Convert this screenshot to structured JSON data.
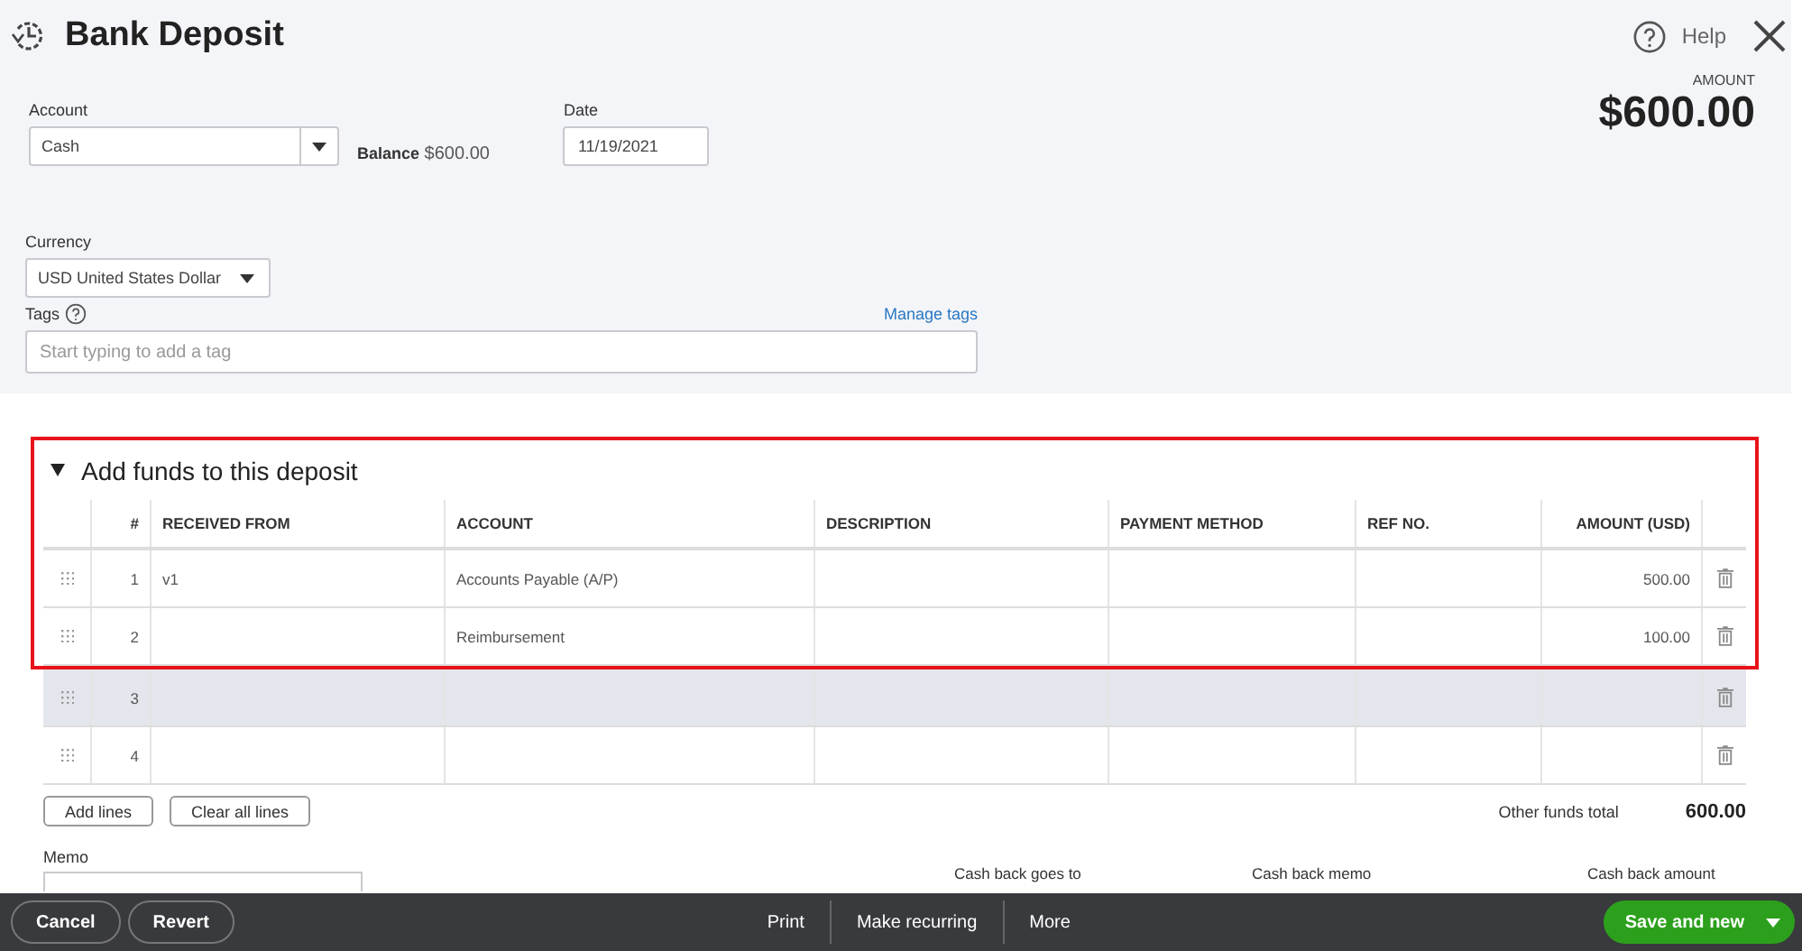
{
  "window": {
    "title": "Bank Deposit",
    "help": "Help"
  },
  "form": {
    "account_label": "Account",
    "account_value": "Cash",
    "balance_label": "Balance",
    "balance_value": "$600.00",
    "date_label": "Date",
    "date_value": "11/19/2021",
    "currency_label": "Currency",
    "currency_value": "USD United States Dollar",
    "tags_label": "Tags",
    "manage_tags": "Manage tags",
    "tags_placeholder": "Start typing to add a tag",
    "amount_label": "AMOUNT",
    "amount_value": "$600.00"
  },
  "section": {
    "title": "Add funds to this deposit",
    "expanded": true
  },
  "table": {
    "columns": [
      "#",
      "RECEIVED FROM",
      "ACCOUNT",
      "DESCRIPTION",
      "PAYMENT METHOD",
      "REF NO.",
      "AMOUNT (USD)"
    ],
    "rows": [
      {
        "num": "1",
        "received_from": "v1",
        "account": "Accounts Payable (A/P)",
        "amount": "500.00",
        "selected": false,
        "highlighted": true
      },
      {
        "num": "2",
        "received_from": "",
        "account": "Reimbursement",
        "amount": "100.00",
        "selected": false,
        "highlighted": true
      },
      {
        "num": "3",
        "received_from": "",
        "account": "",
        "amount": "",
        "selected": true,
        "highlighted": false
      },
      {
        "num": "4",
        "received_from": "",
        "account": "",
        "amount": "",
        "selected": false,
        "highlighted": false
      }
    ]
  },
  "table_buttons": [
    "Add lines",
    "Clear all lines"
  ],
  "total": {
    "label": "Other funds total",
    "value": "600.00"
  },
  "lower": {
    "memo_label": "Memo",
    "cash_back_labels": [
      "Cash back goes to",
      "Cash back memo",
      "Cash back amount"
    ]
  },
  "footer": {
    "left_buttons": [
      "Cancel",
      "Revert"
    ],
    "center_links": [
      "Print",
      "Make recurring",
      "More"
    ],
    "primary_button": "Save and new"
  }
}
